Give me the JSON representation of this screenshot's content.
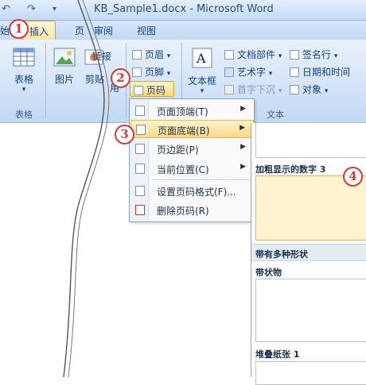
{
  "window": {
    "title": "KB_Sample1.docx - Microsoft Word",
    "undo_glyph": "↶",
    "redo_glyph": "↷",
    "customize_glyph": "▾"
  },
  "tabs": [
    {
      "label": "始",
      "active": false
    },
    {
      "label": "插入",
      "active": true
    },
    {
      "label": "页",
      "active": false
    },
    {
      "label": "审阅",
      "active": false
    },
    {
      "label": "视图",
      "active": false
    }
  ],
  "ribbon": {
    "table_label": "表格",
    "table_group_label": "表格",
    "picture_label": "图片",
    "clip_label": "剪贴",
    "clip_suffix": "用",
    "link_label": "链接",
    "header_label": "页眉",
    "footer_label": "页脚",
    "pagenum_label": "页码",
    "textbox_label": "文本框",
    "textbox_icon_text": "A",
    "doc_parts_label": "文档部件",
    "wordart_label": "艺术字",
    "dropcap_label": "首字下沉",
    "signature_label": "签名行",
    "datetime_label": "日期和时间",
    "object_label": "对象",
    "text_group_label": "文本",
    "caret": "▾"
  },
  "menu": {
    "items": [
      {
        "label": "页面顶端(T)",
        "arrow": "▶"
      },
      {
        "label": "页面底端(B)",
        "arrow": "▶"
      },
      {
        "label": "页边距(P)",
        "arrow": "▶"
      },
      {
        "label": "当前位置(C)",
        "arrow": "▶"
      },
      {
        "label": "设置页码格式(F)...",
        "arrow": ""
      },
      {
        "label": "删除页码(R)",
        "arrow": ""
      }
    ]
  },
  "gallery": {
    "bold_number_label": "加粗显示的数字 3",
    "shapes_header": "带有多种形状",
    "ribbon_label": "带状物",
    "stacked_label": "堆叠纸张 1"
  },
  "annotations": [
    "1",
    "2",
    "3",
    "4"
  ],
  "colors": {
    "accent_red": "#d23a3a",
    "highlight": "#ffd98a",
    "ribbon_blue": "#c4d9f4"
  }
}
